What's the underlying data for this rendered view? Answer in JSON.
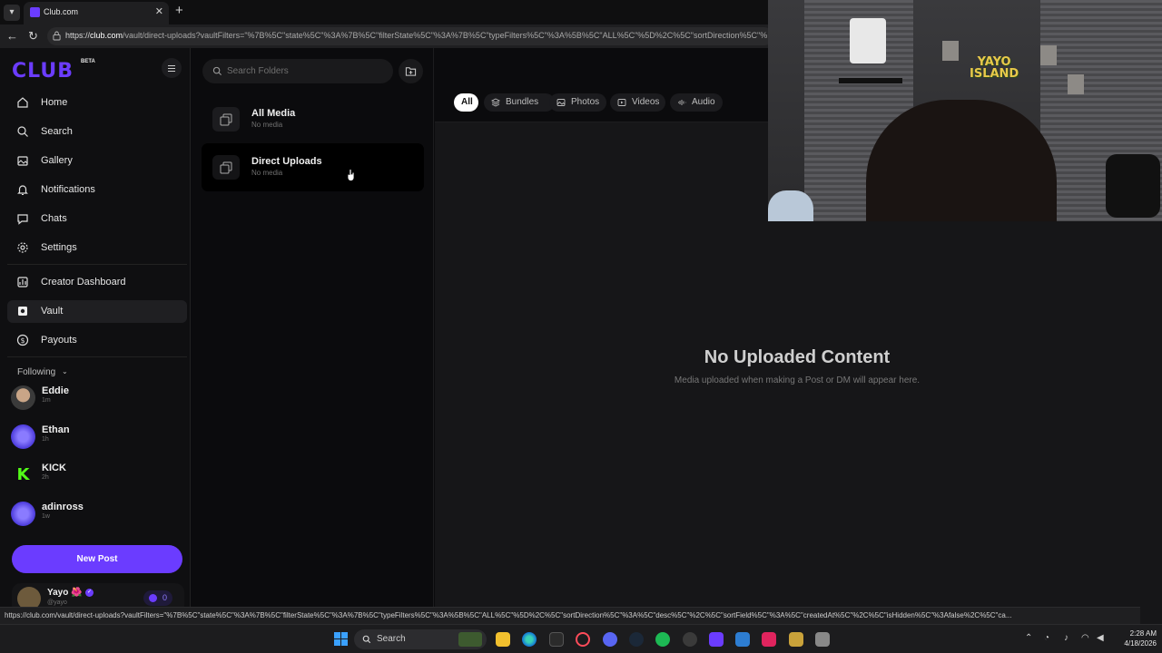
{
  "browser": {
    "tab_title": "Club.com",
    "url_host": "club.com",
    "url_path": "/vault/direct-uploads?vaultFilters=\"%7B%5C\"state%5C\"%3A%7B%5C\"filterState%5C\"%3A%7B%5C\"typeFilters%5C\"%3A%5B%5C\"ALL%5C\"%5D%2C%5C\"sortDirection%5C\"%",
    "status_link": "https://club.com/vault/direct-uploads?vaultFilters=\"%7B%5C\"state%5C\"%3A%7B%5C\"filterState%5C\"%3A%7B%5C\"typeFilters%5C\"%3A%5B%5C\"ALL%5C\"%5D%2C%5C\"sortDirection%5C\"%3A%5C\"desc%5C\"%2C%5C\"sortField%5C\"%3A%5C\"createdAt%5C\"%2C%5C\"isHidden%5C\"%3Afalse%2C%5C\"ca..."
  },
  "sidebar": {
    "logo": "CLUB",
    "logo_badge": "BETA",
    "nav": [
      {
        "label": "Home",
        "icon": "home-icon"
      },
      {
        "label": "Search",
        "icon": "search-icon"
      },
      {
        "label": "Gallery",
        "icon": "gallery-icon"
      },
      {
        "label": "Notifications",
        "icon": "bell-icon"
      },
      {
        "label": "Chats",
        "icon": "chat-icon"
      },
      {
        "label": "Settings",
        "icon": "gear-icon"
      },
      {
        "label": "Creator Dashboard",
        "icon": "dashboard-icon"
      },
      {
        "label": "Vault",
        "icon": "vault-icon",
        "active": true
      },
      {
        "label": "Payouts",
        "icon": "dollar-icon"
      }
    ],
    "following_label": "Following",
    "following": [
      {
        "name": "Eddie",
        "time": "1m"
      },
      {
        "name": "Ethan",
        "time": "1h"
      },
      {
        "name": "KICK",
        "time": "2h"
      },
      {
        "name": "adinross",
        "time": "1w"
      }
    ],
    "new_post_label": "New Post",
    "user": {
      "name": "Yayo",
      "emoji": "🌺",
      "handle": "@yayo",
      "coins": "0"
    }
  },
  "folders": {
    "search_placeholder": "Search Folders",
    "items": [
      {
        "title": "All Media",
        "subtitle": "No media"
      },
      {
        "title": "Direct Uploads",
        "subtitle": "No media",
        "active": true
      }
    ]
  },
  "main": {
    "filters": [
      {
        "label": "All",
        "active": true
      },
      {
        "label": "Bundles",
        "icon": "bundle-icon"
      },
      {
        "label": "Photos",
        "icon": "photo-icon"
      },
      {
        "label": "Videos",
        "icon": "video-icon"
      },
      {
        "label": "Audio",
        "icon": "audio-icon"
      }
    ],
    "empty_title": "No Uploaded Content",
    "empty_subtitle": "Media uploaded when making a Post or DM will appear here."
  },
  "webcam": {
    "sign_line1": "YAYO",
    "sign_line2": "ISLAND"
  },
  "taskbar": {
    "search_label": "Search",
    "time": "2:28 AM",
    "date": "4/18/2026"
  },
  "colors": {
    "accent": "#6b3cff",
    "background": "#0b0b0d",
    "panel": "#161618"
  }
}
